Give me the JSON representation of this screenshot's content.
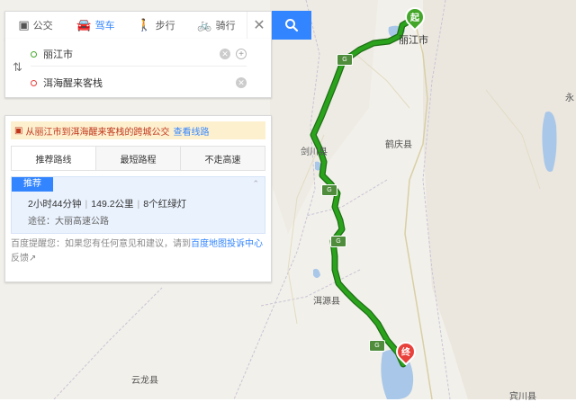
{
  "modes": [
    {
      "label": "公交",
      "icon": "bus-icon",
      "active": false
    },
    {
      "label": "驾车",
      "icon": "car-icon",
      "active": true
    },
    {
      "label": "步行",
      "icon": "walk-icon",
      "active": false
    },
    {
      "label": "骑行",
      "icon": "bike-icon",
      "active": false
    }
  ],
  "route": {
    "start": "丽江市",
    "end": "洱海醒来客栈"
  },
  "notice": {
    "text": "从丽江市到洱海醒来客栈的跨城公交",
    "link": "查看线路"
  },
  "tabs": [
    "推荐路线",
    "最短路程",
    "不走高速"
  ],
  "result": {
    "tag": "推荐",
    "duration": "2小时44分钟",
    "distance": "149.2公里",
    "lights": "8个红绿灯",
    "via": "途径：大丽高速公路"
  },
  "feedback": {
    "prefix": "百度提醒您：如果您有任何意见和建议，请到",
    "link": "百度地图投诉中心",
    "suffix": "反馈↗"
  },
  "map": {
    "start_marker": "起",
    "end_marker": "终",
    "places": {
      "lijiang": "丽江市",
      "jianchuan": "剑川县",
      "heqing": "鹤庆县",
      "eryuan": "洱源县",
      "yunlong": "云龙县",
      "binchuan": "宾川县",
      "yong": "永"
    },
    "highway_sign": "G"
  },
  "colors": {
    "accent": "#3385ff",
    "route": "#2aa21c",
    "route_outline": "#1d6e14",
    "end_marker": "#e8413b",
    "start_marker": "#45a72a",
    "water": "#a9c7e8"
  }
}
